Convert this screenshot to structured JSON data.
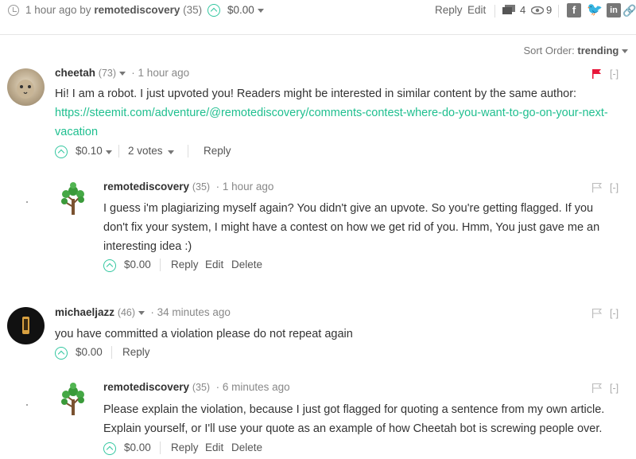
{
  "post_meta": {
    "time_text": "1 hour ago by",
    "author": "remotediscovery",
    "author_rep": "(35)",
    "payout": "$0.00",
    "reply_label": "Reply",
    "edit_label": "Edit",
    "comments_count": "4",
    "views_count": "9",
    "share": {
      "facebook": "f",
      "linkedin": "in"
    }
  },
  "sort": {
    "label": "Sort Order:",
    "value": "trending"
  },
  "comments": [
    {
      "author": "cheetah",
      "rep": "(73)",
      "time": "1 hour ago",
      "body_text": "Hi! I am a robot. I just upvoted you! Readers might be interested in similar content by the same author:",
      "link": "https://steemit.com/adventure/@remotediscovery/comments-contest-where-do-you-want-to-go-on-your-next-vacation",
      "payout": "$0.10",
      "votes": "2 votes",
      "reply_label": "Reply",
      "collapse": "[-]"
    },
    {
      "author": "remotediscovery",
      "rep": "(35)",
      "time": "1 hour ago",
      "body_text": "I guess i'm plagiarizing myself again? You didn't give an upvote. So you're getting flagged. If you don't fix your system, I might have a contest on how we get rid of you. Hmm, You just gave me an interesting idea :)",
      "payout": "$0.00",
      "reply_label": "Reply",
      "edit_label": "Edit",
      "delete_label": "Delete",
      "collapse": "[-]"
    },
    {
      "author": "michaeljazz",
      "rep": "(46)",
      "time": "34 minutes ago",
      "body_text": "you have committed a violation please do not repeat again",
      "payout": "$0.00",
      "reply_label": "Reply",
      "collapse": "[-]"
    },
    {
      "author": "remotediscovery",
      "rep": "(35)",
      "time": "6 minutes ago",
      "body_text": "Please explain the violation, because I just got flagged for quoting a sentence from my own article. Explain yourself, or I'll use your quote as an example of how Cheetah bot is screwing people over.",
      "payout": "$0.00",
      "reply_label": "Reply",
      "edit_label": "Edit",
      "delete_label": "Delete",
      "collapse": "[-]"
    }
  ],
  "colors": {
    "accent": "#1fbf8f",
    "flag_active": "#e8163a",
    "text": "#333333"
  }
}
